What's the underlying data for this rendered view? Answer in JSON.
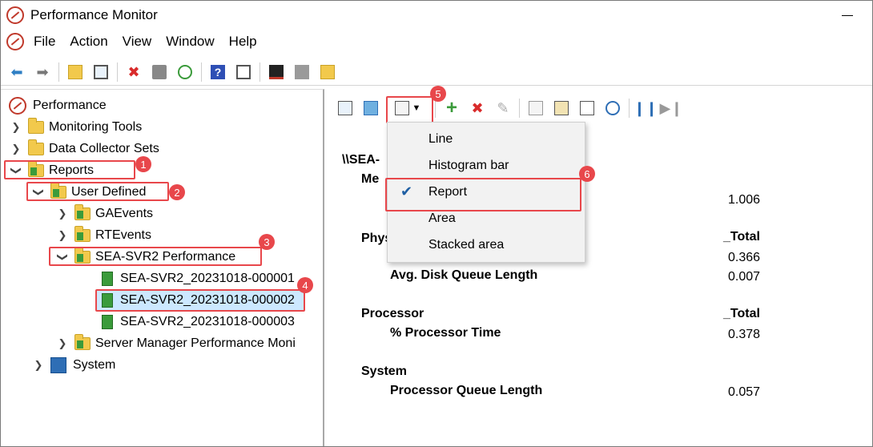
{
  "window": {
    "title": "Performance Monitor"
  },
  "menu": {
    "items": [
      "File",
      "Action",
      "View",
      "Window",
      "Help"
    ]
  },
  "toolbar": {
    "icons": [
      "back-icon",
      "forward-icon",
      "up-folder-icon",
      "show-hide-console-tree-icon",
      "delete-icon",
      "print-icon",
      "refresh-icon",
      "help-icon",
      "show-action-pane-icon",
      "performance-graph-icon",
      "stop-icon",
      "folder-icon"
    ]
  },
  "tree": {
    "root": "Performance",
    "monitoring_tools": "Monitoring Tools",
    "data_collector_sets": "Data Collector Sets",
    "reports": "Reports",
    "user_defined": "User Defined",
    "ga_events": "GAEvents",
    "rt_events": "RTEvents",
    "sea_svr2": "SEA-SVR2 Performance",
    "report_1": "SEA-SVR2_20231018-000001",
    "report_2": "SEA-SVR2_20231018-000002",
    "report_3": "SEA-SVR2_20231018-000003",
    "server_manager": "Server Manager Performance Moni",
    "system": "System"
  },
  "badges": {
    "b1": "1",
    "b2": "2",
    "b3": "3",
    "b4": "4",
    "b5": "5",
    "b6": "6"
  },
  "graph_menu": {
    "items": [
      "Line",
      "Histogram bar",
      "Report",
      "Area",
      "Stacked area"
    ],
    "checked": "Report"
  },
  "report": {
    "machine": "\\\\SEA-",
    "memory_label": "Me",
    "memory_value": "1.006",
    "physical_label": "Phys",
    "physical_instance": "_Total",
    "physical_value": "0.366",
    "disk_queue_label": "Avg. Disk Queue Length",
    "disk_queue_value": "0.007",
    "processor_label": "Processor",
    "processor_instance": "_Total",
    "processor_time_label": "% Processor Time",
    "processor_time_value": "0.378",
    "system_label": "System",
    "pql_label": "Processor Queue Length",
    "pql_value": "0.057"
  },
  "colors": {
    "callout": "#e8474b",
    "selection": "#cce8ff",
    "check": "#1f5fa3"
  }
}
